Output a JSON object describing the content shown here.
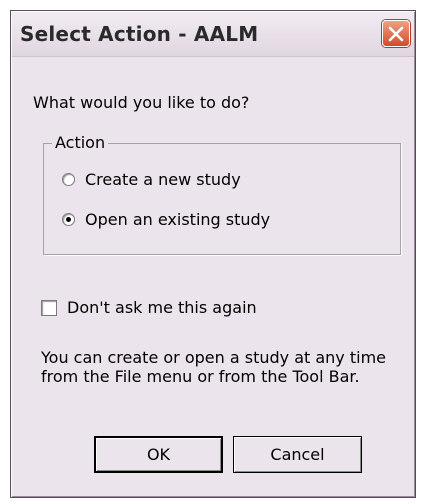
{
  "window": {
    "title": "Select Action - AALM"
  },
  "prompt": "What would you like to do?",
  "action_group": {
    "legend": "Action",
    "options": [
      {
        "label": "Create a new study",
        "selected": false
      },
      {
        "label": "Open an existing study",
        "selected": true
      }
    ]
  },
  "dont_ask": {
    "label": "Don't ask me this again",
    "checked": false
  },
  "help_text": "You can create or open a study at any time from the File menu or from the Tool Bar.",
  "buttons": {
    "ok": "OK",
    "cancel": "Cancel"
  },
  "icons": {
    "close": "close-icon"
  },
  "colors": {
    "dialog_bg": "#ece4ec",
    "close_red": "#d24a2a"
  }
}
